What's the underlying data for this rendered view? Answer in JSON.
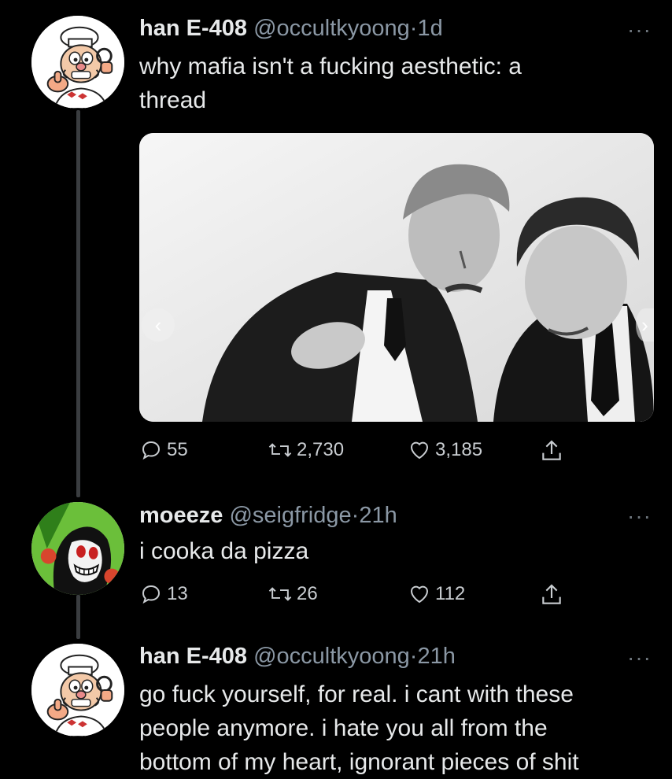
{
  "tweets": [
    {
      "name": "han E-408",
      "handle": "@occultkyoong",
      "separator": "·",
      "time": "1d",
      "text_lines": [
        "why mafia isn't a fucking aesthetic: a",
        "thread"
      ],
      "avatar_icon": "pizza-chef-avatar",
      "media": {
        "type": "photo",
        "description_icon": "black-and-white-photo"
      },
      "stats": {
        "replies": "55",
        "retweets": "2,730",
        "likes": "3,185"
      }
    },
    {
      "name": "moeeze",
      "handle": "@seigfridge",
      "separator": "·",
      "time": "21h",
      "text_lines": [
        "i cooka da pizza"
      ],
      "avatar_icon": "cartoon-character-avatar",
      "stats": {
        "replies": "13",
        "retweets": "26",
        "likes": "112"
      }
    },
    {
      "name": "han E-408",
      "handle": "@occultkyoong",
      "separator": "·",
      "time": "21h",
      "text_lines": [
        "go fuck yourself, for real. i cant with these",
        "people anymore. i hate you all from the",
        "bottom of my heart, ignorant pieces of shit"
      ],
      "avatar_icon": "pizza-chef-avatar"
    }
  ],
  "more_glyph": "···",
  "colors": {
    "background": "#000000",
    "text": "#e7e9ea",
    "muted": "#8b98a5",
    "thread_line": "#3a3d40"
  }
}
